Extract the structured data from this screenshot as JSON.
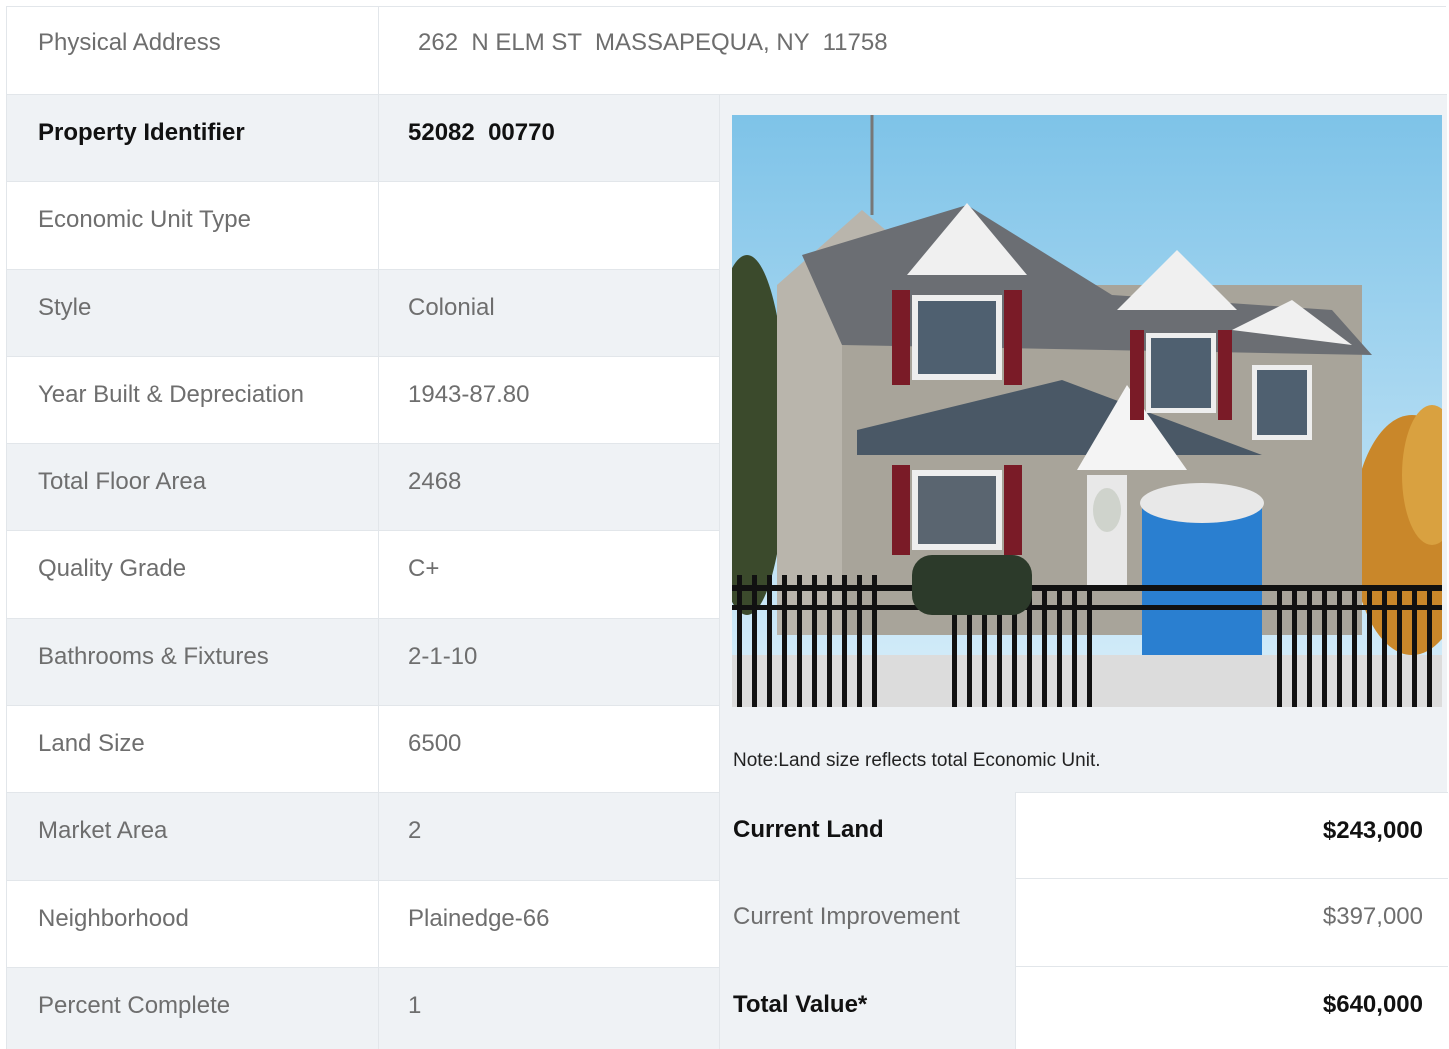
{
  "address": {
    "label": "Physical Address",
    "value": "262  N ELM ST  MASSAPEQUA, NY  11758"
  },
  "property_rows": [
    {
      "label": "Property Identifier",
      "value": "52082  00770",
      "bold": true
    },
    {
      "label": "Economic Unit Type",
      "value": ""
    },
    {
      "label": "Style",
      "value": "Colonial"
    },
    {
      "label": "Year Built & Depreciation",
      "value": "1943-87.80"
    },
    {
      "label": "Total Floor Area",
      "value": "2468"
    },
    {
      "label": "Quality Grade",
      "value": "C+"
    },
    {
      "label": "Bathrooms & Fixtures",
      "value": "2-1-10"
    },
    {
      "label": "Land Size",
      "value": "6500"
    },
    {
      "label": "Market Area",
      "value": "2"
    },
    {
      "label": "Neighborhood",
      "value": "Plainedge-66"
    },
    {
      "label": "Percent Complete",
      "value": "1"
    }
  ],
  "note": "Note:Land size reflects total Economic Unit.",
  "valuation": [
    {
      "label": "Current Land",
      "amount": "$243,000",
      "bold": true
    },
    {
      "label": "Current Improvement",
      "amount": "$397,000",
      "bold": false
    },
    {
      "label": "Total Value*",
      "amount": "$640,000",
      "bold": true
    }
  ],
  "colors": {
    "row_shade": "#eff2f5",
    "border": "#e2e6ea",
    "muted_text": "#6e6e6e",
    "strong_text": "#111111"
  }
}
